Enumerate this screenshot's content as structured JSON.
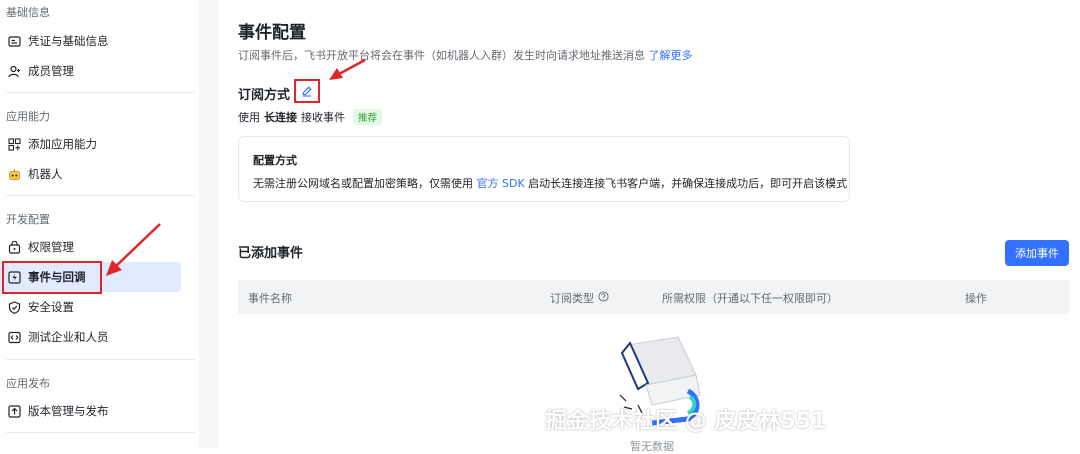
{
  "sidebar": {
    "sections": [
      {
        "title": "基础信息",
        "items": [
          {
            "label": "凭证与基础信息",
            "icon": "id-card-icon"
          },
          {
            "label": "成员管理",
            "icon": "user-add-icon"
          }
        ]
      },
      {
        "title": "应用能力",
        "items": [
          {
            "label": "添加应用能力",
            "icon": "app-grid-icon"
          },
          {
            "label": "机器人",
            "icon": "robot-icon"
          }
        ]
      },
      {
        "title": "开发配置",
        "items": [
          {
            "label": "权限管理",
            "icon": "key-icon"
          },
          {
            "label": "事件与回调",
            "icon": "event-icon",
            "active": true
          },
          {
            "label": "安全设置",
            "icon": "shield-icon"
          },
          {
            "label": "测试企业和人员",
            "icon": "code-icon"
          }
        ]
      },
      {
        "title": "应用发布",
        "items": [
          {
            "label": "版本管理与发布",
            "icon": "upload-icon"
          }
        ]
      }
    ]
  },
  "main": {
    "title": "事件配置",
    "desc": "订阅事件后，飞书开放平台将会在事件（如机器人入群）发生时向请求地址推送消息",
    "learn_more": "了解更多",
    "subscription_label": "订阅方式",
    "use_prefix": "使用",
    "use_method": "长连接",
    "use_suffix": "接收事件",
    "recommend_tag": "推荐",
    "card": {
      "title": "配置方式",
      "text_before": "无需注册公网域名或配置加密策略，仅需使用",
      "link": "官方 SDK",
      "text_after": "启动长连接连接飞书客户端，并确保连接成功后，即可开启该模式"
    },
    "added_events_label": "已添加事件",
    "add_event_button": "添加事件",
    "table": {
      "headers": [
        "事件名称",
        "订阅类型",
        "所需权限（开通以下任一权限即可）",
        "操作"
      ]
    },
    "empty_text": "暂无数据"
  },
  "watermark": "掘金技术社区 @ 皮皮林551",
  "colors": {
    "accent": "#3370ff",
    "annotation_red": "#e0262b",
    "active_bg": "#e1eaff"
  }
}
